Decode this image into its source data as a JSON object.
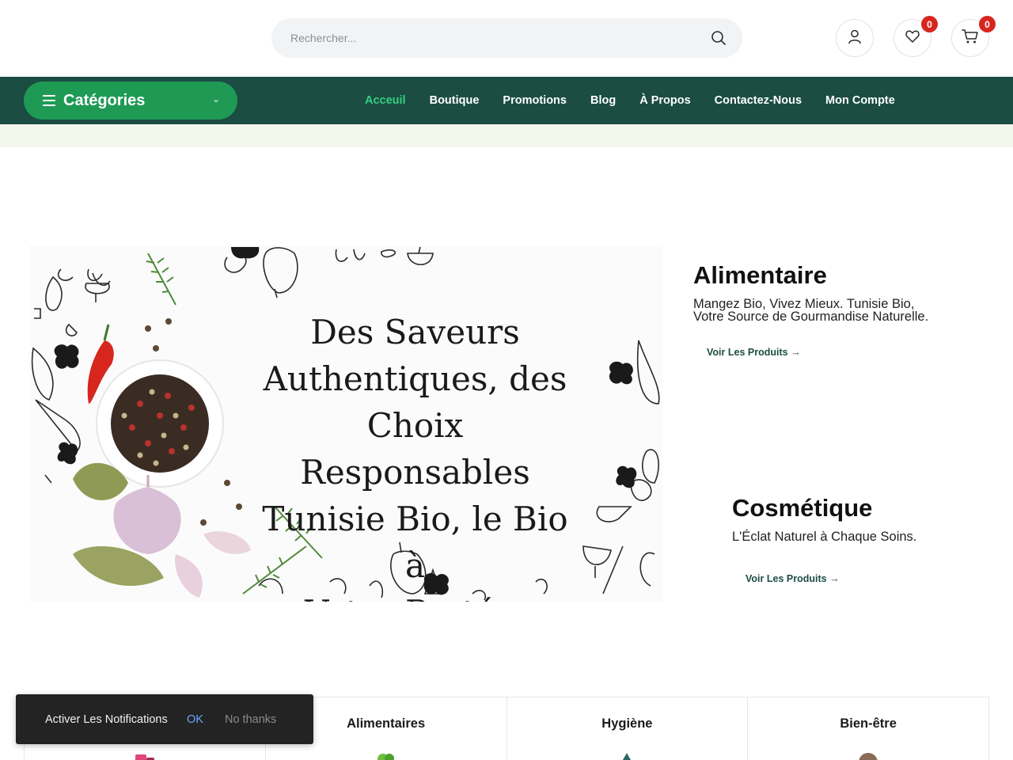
{
  "header": {
    "search": {
      "placeholder": "Rechercher...",
      "value": ""
    },
    "wishlist_count": "0",
    "cart_count": "0"
  },
  "nav": {
    "categories_label": "Catégories",
    "links": [
      {
        "label": "Acceuil",
        "active": true
      },
      {
        "label": "Boutique"
      },
      {
        "label": "Promotions"
      },
      {
        "label": "Blog"
      },
      {
        "label": "À Propos"
      },
      {
        "label": "Contactez-Nous"
      },
      {
        "label": "Mon Compte"
      }
    ]
  },
  "hero": {
    "title_lines": [
      "Des Saveurs",
      "Authentiques, des",
      "Choix Responsables",
      "Tunisie Bio, le Bio à",
      "Votre Portée."
    ]
  },
  "promos": [
    {
      "title": "Alimentaire",
      "text_lines": [
        "Mangez Bio, Vivez Mieux. Tunisie Bio,",
        "Votre Source de Gourmandise Naturelle."
      ],
      "link": "Voir Les Produits"
    },
    {
      "title": "Cosmétique",
      "text_lines": [
        "L'Éclat Naturel à Chaque Soins."
      ],
      "link": "Voir Les Produits"
    }
  ],
  "category_row": [
    {
      "name": ""
    },
    {
      "name": "Alimentaires"
    },
    {
      "name": "Hygiène"
    },
    {
      "name": "Bien-être"
    }
  ],
  "toast": {
    "message": "Activer Les Notifications",
    "ok": "OK",
    "dismiss": "No thanks"
  },
  "colors": {
    "nav_bg": "#1b4d43",
    "accent_green": "#1f9a55",
    "active_link": "#35d07f",
    "badge": "#d7261f"
  }
}
